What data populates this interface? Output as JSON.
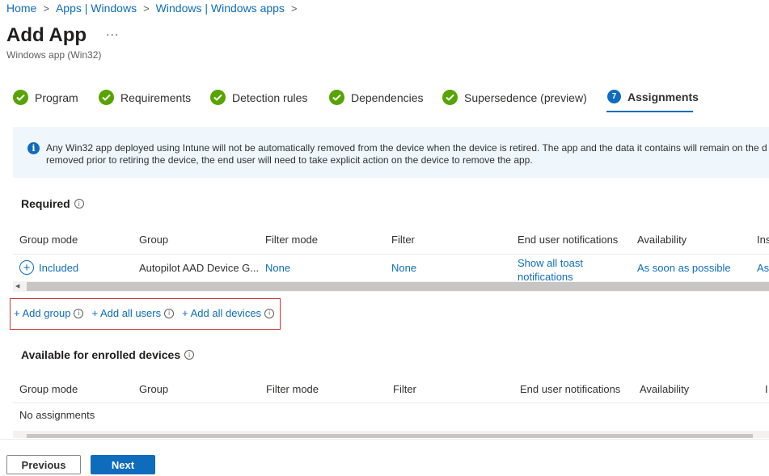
{
  "breadcrumb": {
    "items": [
      "Home",
      "Apps | Windows",
      "Windows | Windows apps"
    ],
    "separator": ">"
  },
  "header": {
    "title": "Add App",
    "more": "...",
    "subtitle": "Windows app (Win32)"
  },
  "steps": [
    {
      "label": "Program",
      "status": "complete"
    },
    {
      "label": "Requirements",
      "status": "complete"
    },
    {
      "label": "Detection rules",
      "status": "complete"
    },
    {
      "label": "Dependencies",
      "status": "complete"
    },
    {
      "label": "Supersedence (preview)",
      "status": "complete"
    },
    {
      "label": "Assignments",
      "status": "active",
      "number": "7"
    }
  ],
  "banner": {
    "line1": "Any Win32 app deployed using Intune will not be automatically removed from the device when the device is retired. The app and the data it contains will remain on the d",
    "line2": "removed prior to retiring the device, the end user will need to take explicit action on the device to remove the app."
  },
  "required": {
    "title": "Required",
    "columns": [
      "Group mode",
      "Group",
      "Filter mode",
      "Filter",
      "End user notifications",
      "Availability",
      "Ins"
    ],
    "rows": [
      {
        "group_mode": "Included",
        "group": "Autopilot AAD Device G...",
        "filter_mode": "None",
        "filter": "None",
        "notifications_line1": "Show all toast",
        "notifications_line2": "notifications",
        "availability": "As soon as possible",
        "installation": "As"
      }
    ],
    "add_links": [
      "+ Add group",
      "+ Add all users",
      "+ Add all devices"
    ]
  },
  "available": {
    "title": "Available for enrolled devices",
    "columns": [
      "Group mode",
      "Group",
      "Filter mode",
      "Filter",
      "End user notifications",
      "Availability",
      "I"
    ],
    "empty_text": "No assignments"
  },
  "footer": {
    "previous": "Previous",
    "next": "Next"
  },
  "colors": {
    "accent": "#0f6cbd",
    "success": "#57a300",
    "highlight_box": "#d13438",
    "banner_bg": "#eff6fc"
  }
}
